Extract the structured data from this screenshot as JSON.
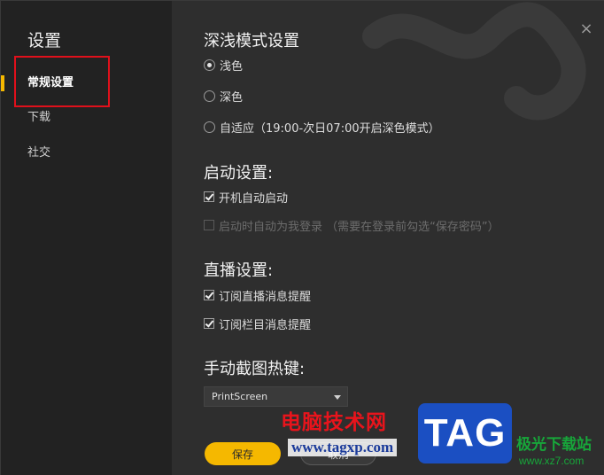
{
  "sidebar": {
    "title": "设置",
    "items": [
      {
        "label": "常规设置"
      },
      {
        "label": "下载"
      },
      {
        "label": "社交"
      }
    ]
  },
  "theme": {
    "title": "深浅模式设置",
    "options": [
      {
        "label": "浅色",
        "selected": true
      },
      {
        "label": "深色",
        "selected": false
      },
      {
        "label": "自适应（19:00-次日07:00开启深色模式）",
        "selected": false
      }
    ]
  },
  "startup": {
    "title": "启动设置:",
    "options": [
      {
        "label": "开机自动启动",
        "checked": true
      },
      {
        "label": "启动时自动为我登录 （需要在登录前勾选“保存密码”）",
        "checked": false,
        "disabled": true
      }
    ]
  },
  "live": {
    "title": "直播设置:",
    "options": [
      {
        "label": "订阅直播消息提醒",
        "checked": true
      },
      {
        "label": "订阅栏目消息提醒",
        "checked": true
      }
    ]
  },
  "hotkey": {
    "title": "手动截图热键:",
    "value": "PrintScreen"
  },
  "footer": {
    "save_label": "保存",
    "cancel_label": "取消"
  },
  "watermark": {
    "title": "电脑技术网",
    "url": "www.tagxp.com",
    "tag": "TAG",
    "site_name": "极光下载站",
    "site_url": "www.xz7.com"
  },
  "colors": {
    "accent": "#f5b800",
    "highlight": "#e0101b"
  }
}
